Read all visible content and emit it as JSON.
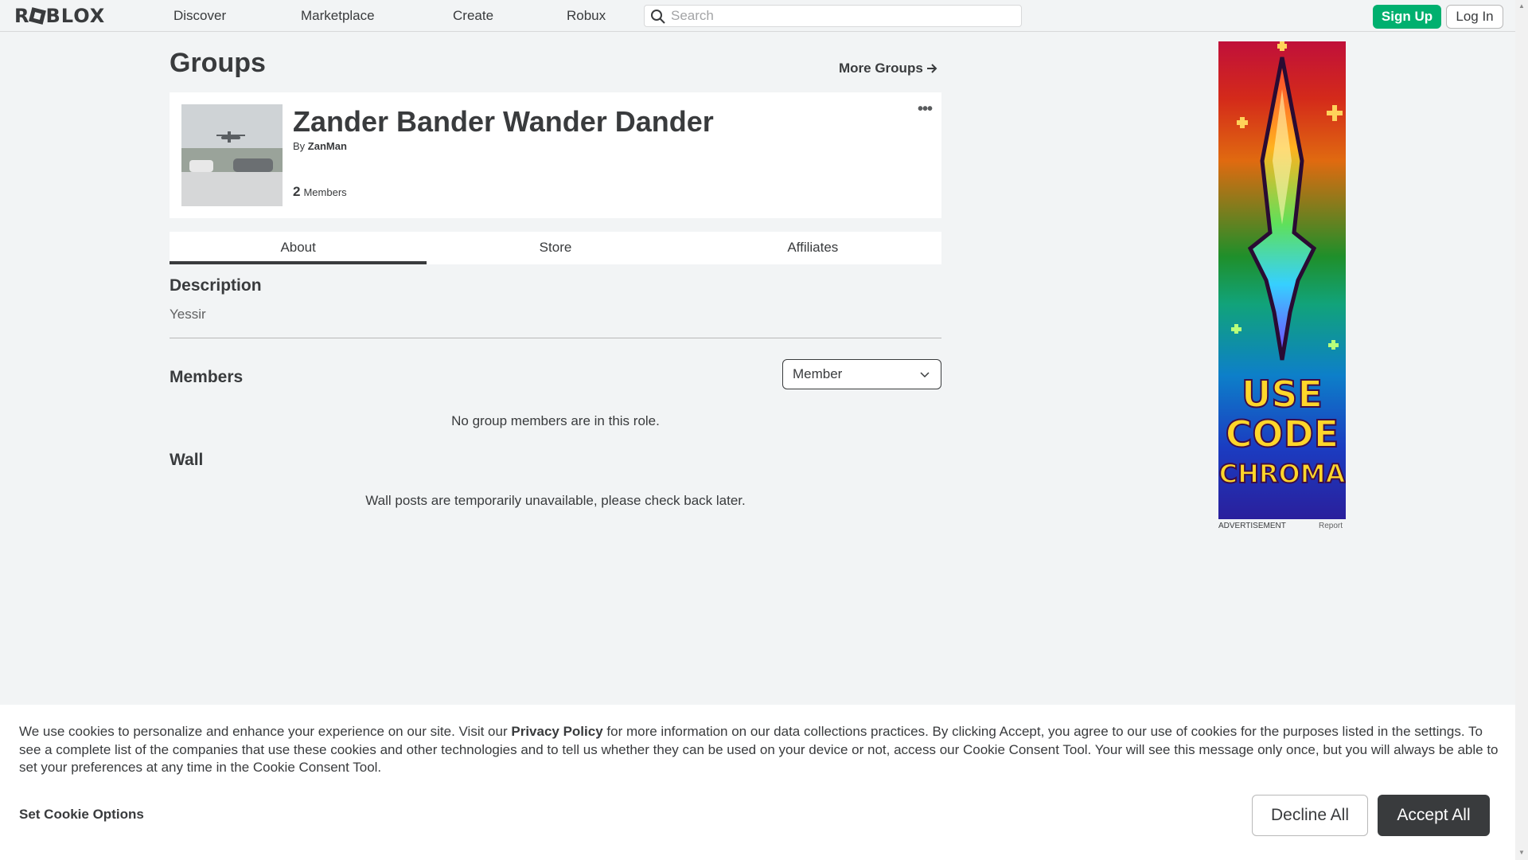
{
  "nav": {
    "logo": "ROBLOX",
    "links": [
      "Discover",
      "Marketplace",
      "Create",
      "Robux"
    ],
    "search_placeholder": "Search",
    "signup_label": "Sign Up",
    "login_label": "Log In"
  },
  "page": {
    "title": "Groups",
    "more_groups": "More Groups"
  },
  "group": {
    "name": "Zander Bander Wander Dander",
    "by_label": "By",
    "owner": "ZanMan",
    "member_count": "2",
    "members_label": "Members"
  },
  "tabs": [
    "About",
    "Store",
    "Affiliates"
  ],
  "about": {
    "description_heading": "Description",
    "description": "Yessir",
    "members_heading": "Members",
    "role_selected": "Member",
    "no_members": "No group members are in this role.",
    "wall_heading": "Wall",
    "wall_message": "Wall posts are temporarily unavailable, please check back later."
  },
  "ad": {
    "lines": [
      "USE",
      "CODE",
      "CHROMA"
    ],
    "label": "ADVERTISEMENT",
    "report": "Report"
  },
  "cookie": {
    "text_before": "We use cookies to personalize and enhance your experience on our site. Visit our ",
    "privacy_link": "Privacy Policy",
    "text_after": " for more information on our data collections practices. By clicking Accept, you agree to our use of cookies for the purposes listed in the settings. To see a complete list of the companies that use these cookies and other technologies and to tell us whether they can be used on your device or not, access our Cookie Consent Tool. Your will see this message only once, but you will always be able to set your preferences at any time in the Cookie Consent Tool.",
    "options_label": "Set Cookie Options",
    "decline_label": "Decline All",
    "accept_label": "Accept All"
  },
  "colors": {
    "signup_green": "#00b06f",
    "accept_dark": "#393b3d",
    "background": "#f2f4f5"
  }
}
